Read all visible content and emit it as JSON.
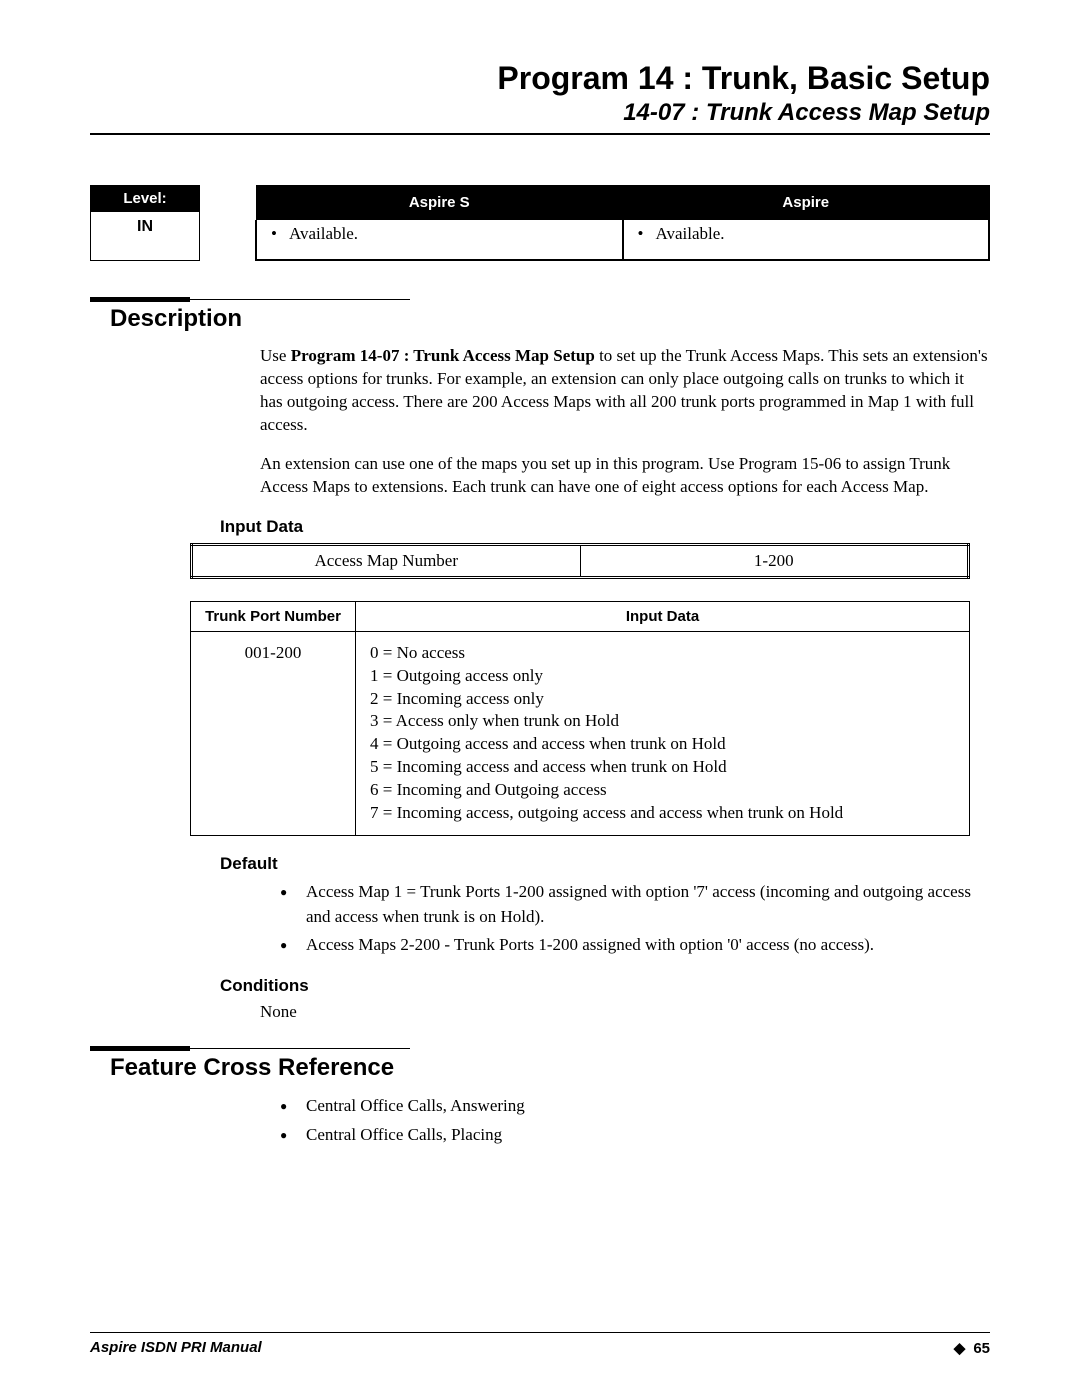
{
  "header": {
    "title": "Program 14 : Trunk, Basic Setup",
    "subtitle": "14-07 : Trunk Access Map Setup"
  },
  "level": {
    "label": "Level:",
    "value": "IN"
  },
  "aspire": {
    "col1_header": "Aspire S",
    "col1_value": "Available.",
    "col2_header": "Aspire",
    "col2_value": "Available."
  },
  "sections": {
    "description_heading": "Description",
    "desc_bold": "Program 14-07 : Trunk Access Map Setup",
    "desc_p1_pre": "Use ",
    "desc_p1_post": " to set up the Trunk Access Maps. This sets an extension's access options for trunks. For example, an extension can only place outgoing calls on trunks to which it has outgoing access. There are 200 Access Maps with all 200 trunk ports programmed in Map 1 with full access.",
    "desc_p2": "An extension can use one of the maps you set up in this program. Use Program 15-06 to assign Trunk Access Maps to extensions. Each trunk can have one of eight access options for each Access Map.",
    "input_data_heading": "Input Data",
    "table1": {
      "c1": "Access Map Number",
      "c2": "1-200"
    },
    "table2": {
      "h1": "Trunk Port Number",
      "h2": "Input Data",
      "r1c1": "001-200",
      "r1c2": "0 = No access\n1 = Outgoing access only\n2 = Incoming access only\n3 = Access only when trunk on Hold\n4 = Outgoing access and access when trunk on Hold\n5 = Incoming access and access when trunk on Hold\n6 = Incoming and Outgoing access\n7 = Incoming access, outgoing access and access when trunk on Hold"
    },
    "default_heading": "Default",
    "default_items": [
      "Access Map 1 = Trunk Ports 1-200 assigned with option '7' access (incoming and outgoing access and access when trunk is on Hold).",
      "Access Maps 2-200 - Trunk Ports 1-200 assigned with option '0' access (no access)."
    ],
    "conditions_heading": "Conditions",
    "conditions_text": "None",
    "feature_heading": "Feature Cross Reference",
    "feature_items": [
      "Central Office Calls, Answering",
      "Central Office Calls, Placing"
    ]
  },
  "footer": {
    "left": "Aspire ISDN PRI Manual",
    "page": "65"
  }
}
